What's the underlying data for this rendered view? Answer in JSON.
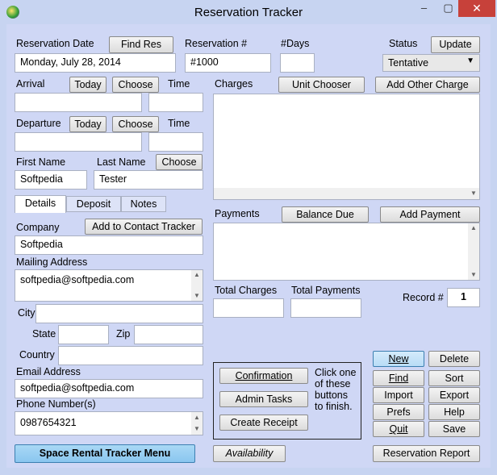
{
  "window": {
    "title": "Reservation Tracker",
    "min": "–",
    "max": "▢",
    "close": "✕"
  },
  "header": {
    "reservation_date_label": "Reservation Date",
    "find_res_btn": "Find Res",
    "reservation_date_value": "Monday, July 28, 2014",
    "reservation_no_label": "Reservation #",
    "reservation_no_value": "#1000",
    "days_label": "#Days",
    "days_value": "",
    "status_label": "Status",
    "update_btn": "Update",
    "status_value": "Tentative"
  },
  "arrival": {
    "label": "Arrival",
    "today_btn": "Today",
    "choose_btn": "Choose",
    "time_label": "Time",
    "date": "",
    "time": ""
  },
  "departure": {
    "label": "Departure",
    "today_btn": "Today",
    "choose_btn": "Choose",
    "time_label": "Time",
    "date": "",
    "time": ""
  },
  "name": {
    "first_label": "First Name",
    "last_label": "Last Name",
    "choose_btn": "Choose",
    "first": "Softpedia",
    "last": "Tester"
  },
  "tabs": [
    "Details",
    "Deposit",
    "Notes"
  ],
  "details": {
    "company_label": "Company",
    "add_contact_btn": "Add to Contact Tracker",
    "company": "Softpedia",
    "mailing_label": "Mailing Address",
    "mailing": "softpedia@softpedia.com",
    "city_label": "City",
    "city": "",
    "state_label": "State",
    "state": "",
    "zip_label": "Zip",
    "zip": "",
    "country_label": "Country",
    "country": "",
    "email_label": "Email Address",
    "email": "softpedia@softpedia.com",
    "phone_label": "Phone Number(s)",
    "phone": "0987654321"
  },
  "charges": {
    "label": "Charges",
    "unit_chooser_btn": "Unit Chooser",
    "add_other_btn": "Add Other Charge"
  },
  "payments": {
    "label": "Payments",
    "balance_due_btn": "Balance Due",
    "add_payment_btn": "Add Payment"
  },
  "totals": {
    "total_charges_label": "Total Charges",
    "total_payments_label": "Total Payments",
    "record_label": "Record #",
    "record_value": "1",
    "total_charges": "",
    "total_payments": ""
  },
  "actions": {
    "confirmation": "Confirmation",
    "admin_tasks": "Admin Tasks",
    "create_receipt": "Create Receipt",
    "hint": [
      "Click one",
      "of these",
      "buttons",
      "to finish."
    ]
  },
  "nav": {
    "new": "New",
    "delete": "Delete",
    "find": "Find",
    "sort": "Sort",
    "import": "Import",
    "export": "Export",
    "prefs": "Prefs",
    "help": "Help",
    "quit": "Quit",
    "save": "Save"
  },
  "footer": {
    "menu_btn": "Space Rental Tracker Menu",
    "availability_btn": "Availability",
    "report_btn": "Reservation Report"
  },
  "colors": {
    "client_bg": "#cfd7f5",
    "title_bg": "#c7d4f1",
    "close_bg": "#c7413a",
    "accent_button": "#8ac6ef"
  }
}
